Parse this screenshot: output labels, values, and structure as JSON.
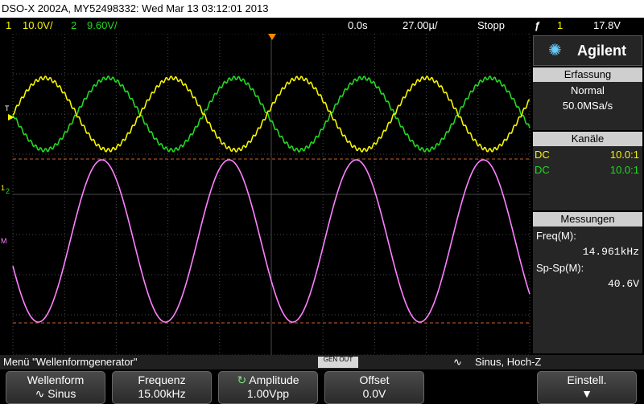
{
  "title_bar": "DSO-X 2002A, MY52498332: Wed Mar 13 03:12:01 2013",
  "status": {
    "ch1_num": "1",
    "ch1_scale": "10.0V/",
    "ch2_num": "2",
    "ch2_scale": "9.60V/",
    "time_offset": "0.0s",
    "time_scale": "27.00µ/",
    "run_state": "Stopp",
    "trigger_icon": "ƒ",
    "trigger_src": "1",
    "trigger_level": "17.8V"
  },
  "screen": {
    "trig_marker": "T",
    "ch1_marker": "1",
    "ch2_marker": "2",
    "math_marker": "M"
  },
  "sidebar": {
    "logo": "Agilent",
    "acq_head": "Erfassung",
    "acq_mode": "Normal",
    "acq_rate": "50.0MSa/s",
    "chan_head": "Kanäle",
    "ch1_coupling": "DC",
    "ch1_probe": "10.0:1",
    "ch2_coupling": "DC",
    "ch2_probe": "10.0:1",
    "meas_head": "Messungen",
    "meas1_label": "Freq(M):",
    "meas1_value": "14.961kHz",
    "meas2_label": "Sp-Sp(M):",
    "meas2_value": "40.6V"
  },
  "menu": {
    "title": "Menü \"Wellenformgenerator\"",
    "gen_label": "GEN OUT",
    "status": "Sinus, Hoch-Z"
  },
  "softkeys": [
    {
      "label": "Wellenform",
      "value": "Sinus"
    },
    {
      "label": "Frequenz",
      "value": "15.00kHz"
    },
    {
      "label": "Amplitude",
      "value": "1.00Vpp"
    },
    {
      "label": "Offset",
      "value": "0.0V"
    },
    {
      "label": "Einstell.",
      "value": ""
    }
  ]
}
